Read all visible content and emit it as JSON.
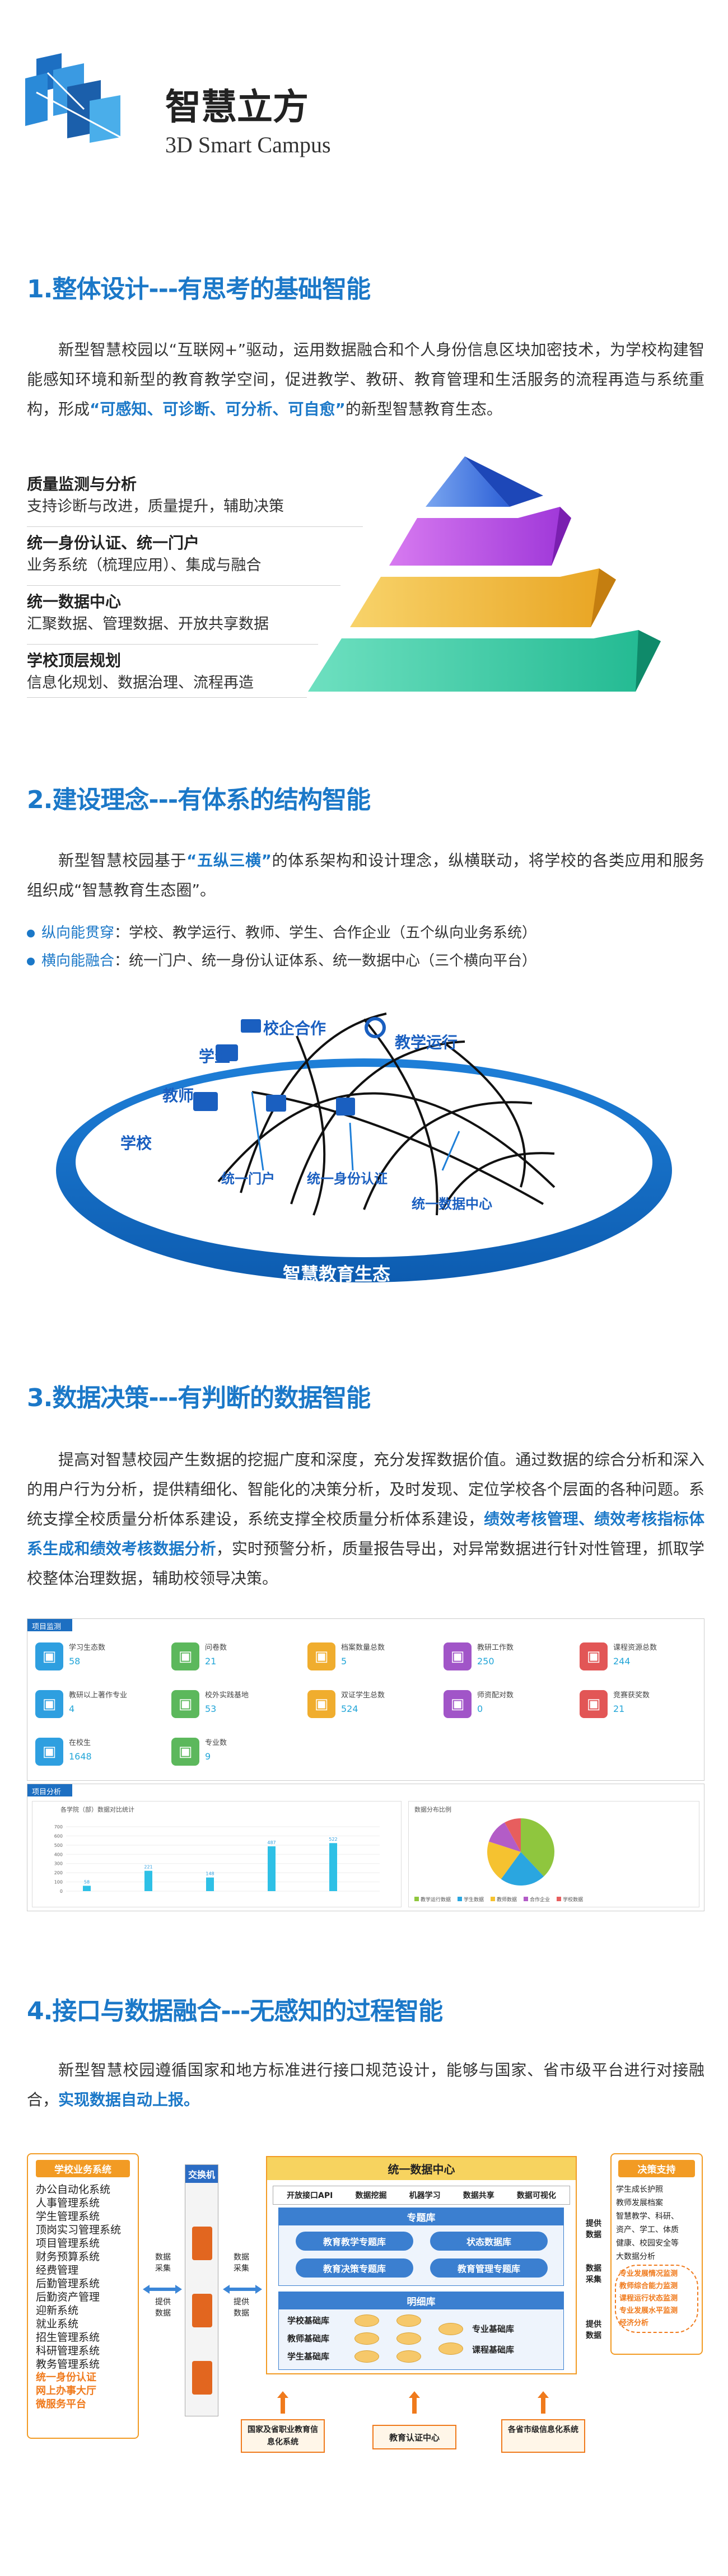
{
  "header": {
    "title": "智慧立方",
    "subtitle": "3D Smart Campus"
  },
  "s1": {
    "title": "1.整体设计---有思考的基础智能",
    "para_a": "新型智慧校园以“互联网+”驱动，运用数据融合和个人身份信息区块加密技术，为学校构建智能感知环境和新型的教育教学空间，促进教学、教研、教育管理和生活服务的流程再造与系统重构，形成",
    "para_hl": "“可感知、可诊断、可分析、可自愈”",
    "para_b": "的新型智慧教育生态。",
    "levels": [
      {
        "title": "质量监测与分析",
        "desc": "支持诊断与改进，质量提升，辅助决策"
      },
      {
        "title": "统一身份认证、统一门户",
        "desc": "业务系统（梳理应用）、集成与融合"
      },
      {
        "title": "统一数据中心",
        "desc": "汇聚数据、管理数据、开放共享数据"
      },
      {
        "title": "学校顶层规划",
        "desc": "信息化规划、数据治理、流程再造"
      }
    ]
  },
  "s2": {
    "title": "2.建设理念---有体系的结构智能",
    "para_a": "新型智慧校园基于",
    "para_hl": "“五纵三横”",
    "para_b": "的体系架构和设计理念，纵横联动，将学校的各类应用和服务组织成“智慧教育生态圈”。",
    "b1_k": "纵向能贯穿",
    "b1_t": "：学校、教学运行、教师、学生、合作企业（五个纵向业务系统）",
    "b2_k": "横向能融合",
    "b2_t": "：统一门户、统一身份认证体系、统一数据中心（三个横向平台）",
    "diagram": {
      "labels": [
        "校企合作",
        "教学运行",
        "学生",
        "教师",
        "学校",
        "统一门户",
        "统一身份认证",
        "统一数据中心"
      ],
      "ring": "智慧教育生态"
    }
  },
  "s3": {
    "title": "3.数据决策---有判断的数据智能",
    "para_a": "提高对智慧校园产生数据的挖掘广度和深度，充分发挥数据价值。通过数据的综合分析和深入的用户行为分析，提供精细化、智能化的决策分析，及时发现、定位学校各个层面的各种问题。系统支撑全校质量分析体系建设，系统支撑全校质量分析体系建设，",
    "para_hl": "绩效考核管理、绩效考核指标体系生成和绩效考核数据分析",
    "para_b": "，实时预警分析，质量报告导出，对异常数据进行针对性管理，抓取学校整体治理数据，辅助校领导决策。",
    "dash": {
      "panel1": "项目监测",
      "panel2": "项目分析",
      "cards": [
        {
          "label": "学习生态数",
          "value": "58",
          "color": "#2e9fe0"
        },
        {
          "label": "问卷数",
          "value": "21",
          "color": "#5cb85c"
        },
        {
          "label": "档案数量总数",
          "value": "5",
          "color": "#f0ad2e"
        },
        {
          "label": "教研工作数",
          "value": "250",
          "color": "#a155c8"
        },
        {
          "label": "课程资源总数",
          "value": "244",
          "color": "#e25656"
        },
        {
          "label": "教研以上著作专业",
          "value": "4",
          "color": "#2e9fe0"
        },
        {
          "label": "校外实践基地",
          "value": "53",
          "color": "#5cb85c"
        },
        {
          "label": "双证学生总数",
          "value": "524",
          "color": "#f0ad2e"
        },
        {
          "label": "师资配对数",
          "value": "0",
          "color": "#a155c8"
        },
        {
          "label": "竞赛获奖数",
          "value": "21",
          "color": "#e25656"
        },
        {
          "label": "在校生",
          "value": "1648",
          "color": "#2e9fe0"
        },
        {
          "label": "专业数",
          "value": "9",
          "color": "#5cb85c"
        }
      ],
      "bar_title": "各学院（部）数据对比统计",
      "pie_title": "数据分布比例",
      "legend": [
        "教学运行数据",
        "学生数据",
        "教师数据",
        "合作企业",
        "学校数据"
      ]
    },
    "chart_data": [
      {
        "type": "bar",
        "title": "各学院（部）数据对比统计",
        "categories": [
          "A",
          "B",
          "C",
          "D",
          "E"
        ],
        "values": [
          58,
          221,
          148,
          487,
          522
        ],
        "ylim": [
          0,
          700
        ],
        "yticks": [
          "700",
          "600",
          "500",
          "400",
          "300",
          "200",
          "100",
          "0"
        ]
      },
      {
        "type": "pie",
        "title": "数据分布比例",
        "values": [
          38,
          22,
          20,
          12,
          8
        ],
        "colors": [
          "#8fc63e",
          "#2aa6e0",
          "#f5c230",
          "#b35cc7",
          "#e75e5e"
        ]
      }
    ]
  },
  "s4": {
    "title": "4.接口与数据融合---无感知的过程智能",
    "para_a": "新型智慧校园遵循国家和地方标准进行接口规范设计，能够与国家、省市级平台进行对接融合，",
    "para_hl": "实现数据自动上报。",
    "left_title": "学校业务系统",
    "left_items": [
      "办公自动化系统",
      "人事管理系统",
      "学生管理系统",
      "顶岗实习管理系统",
      "项目管理系统",
      "财务预算系统",
      "经费管理",
      "后勤管理系统",
      "后勤资产管理",
      "迎新系统",
      "就业系统",
      "招生管理系统",
      "科研管理系统",
      "教务管理系统"
    ],
    "left_hl": [
      "统一身份认证",
      "网上办事大厅",
      "微服务平台"
    ],
    "exchange_title": "交换机",
    "flow_a": [
      "数据",
      "采集"
    ],
    "flow_b": [
      "提供",
      "数据"
    ],
    "flow_c": [
      "数据",
      "采集"
    ],
    "flow_d": [
      "提供",
      "数据"
    ],
    "center_title": "统一数据中心",
    "tools": [
      "开放接口API",
      "数据挖掘",
      "机器学习",
      "数据共享",
      "数据可视化"
    ],
    "topic_title": "专题库",
    "topic": [
      "教育教学专题库",
      "状态数据库",
      "教育决策专题库",
      "教育管理专题库"
    ],
    "detail_title": "明细库",
    "detail": [
      "学校基础库",
      "教师基础库",
      "学生基础库",
      "专业基础库",
      "课程基础库"
    ],
    "provide": [
      "提供",
      "数据"
    ],
    "collect": [
      "数据",
      "采集"
    ],
    "right_title": "决策支持",
    "right_items": [
      "学生成长护照",
      "教师发展档案",
      "智慧教学、科研、",
      "资产、学工、体质",
      "健康、校园安全等",
      "大数据分析"
    ],
    "right_hl": [
      "专业发展情况监测",
      "教师综合能力监测",
      "课程运行状态监测",
      "专业发展水平监测",
      "经济分析"
    ],
    "bottom": [
      "国家及省职业教育信息化系统",
      "教育认证中心",
      "各省市级信息化系统"
    ]
  }
}
